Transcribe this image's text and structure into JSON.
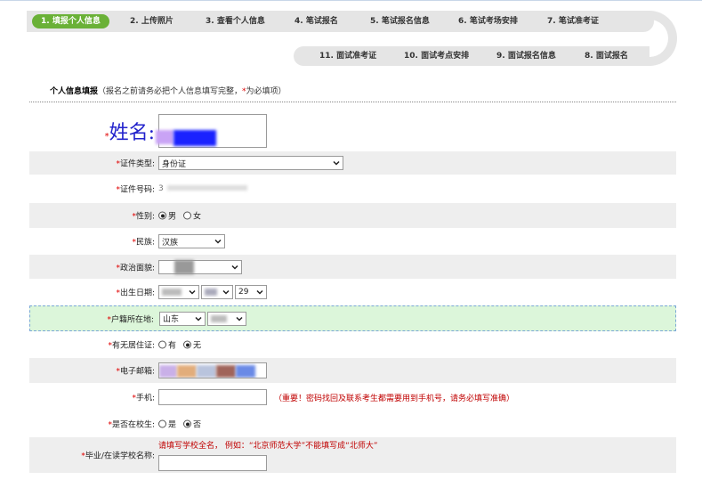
{
  "steps": {
    "row1": [
      {
        "label": "1. 填报个人信息",
        "active": true
      },
      {
        "label": "2. 上传照片"
      },
      {
        "label": "3. 查看个人信息"
      },
      {
        "label": "4. 笔试报名"
      },
      {
        "label": "5. 笔试报名信息"
      },
      {
        "label": "6. 笔试考场安排"
      },
      {
        "label": "7. 笔试准考证"
      }
    ],
    "row2": [
      {
        "label": "11. 面试准考证"
      },
      {
        "label": "10. 面试考点安排"
      },
      {
        "label": "9. 面试报名信息"
      },
      {
        "label": "8. 面试报名"
      }
    ]
  },
  "section": {
    "title": "个人信息填报",
    "note_prefix": "（报名之前请务必把个人信息填写完整，",
    "required_mark": "*",
    "note_suffix": "为必填项）"
  },
  "form": {
    "required_mark": "*",
    "name": {
      "label": "姓名:"
    },
    "id_type": {
      "label": "证件类型:",
      "value": "身份证"
    },
    "id_number": {
      "label": "证件号码:",
      "value": "3"
    },
    "gender": {
      "label": "性别:",
      "options": [
        "男",
        "女"
      ],
      "selected": "男"
    },
    "ethnicity": {
      "label": "民族:",
      "value": "汉族"
    },
    "political": {
      "label": "政治面貌:"
    },
    "birthdate": {
      "label": "出生日期:",
      "day": "29"
    },
    "hukou": {
      "label": "户籍所在地:",
      "province": "山东"
    },
    "residence_permit": {
      "label": "有无居住证:",
      "options": [
        "有",
        "无"
      ],
      "selected": "无"
    },
    "email": {
      "label": "电子邮箱:"
    },
    "mobile": {
      "label": "手机:",
      "hint": "（重要！密码找回及联系考生都需要用到手机号，请务必填写准确）"
    },
    "in_school": {
      "label": "是否在校生:",
      "options": [
        "是",
        "否"
      ],
      "selected": "否"
    },
    "school": {
      "label": "毕业/在读学校名称:",
      "hint": "请填写学校全名， 例如：“北京师范大学”不能填写成“北师大”"
    }
  },
  "colors": {
    "accent": "#6ab137",
    "required": "#e00000",
    "hint": "#c00000",
    "highlight": "#dcf6da"
  }
}
